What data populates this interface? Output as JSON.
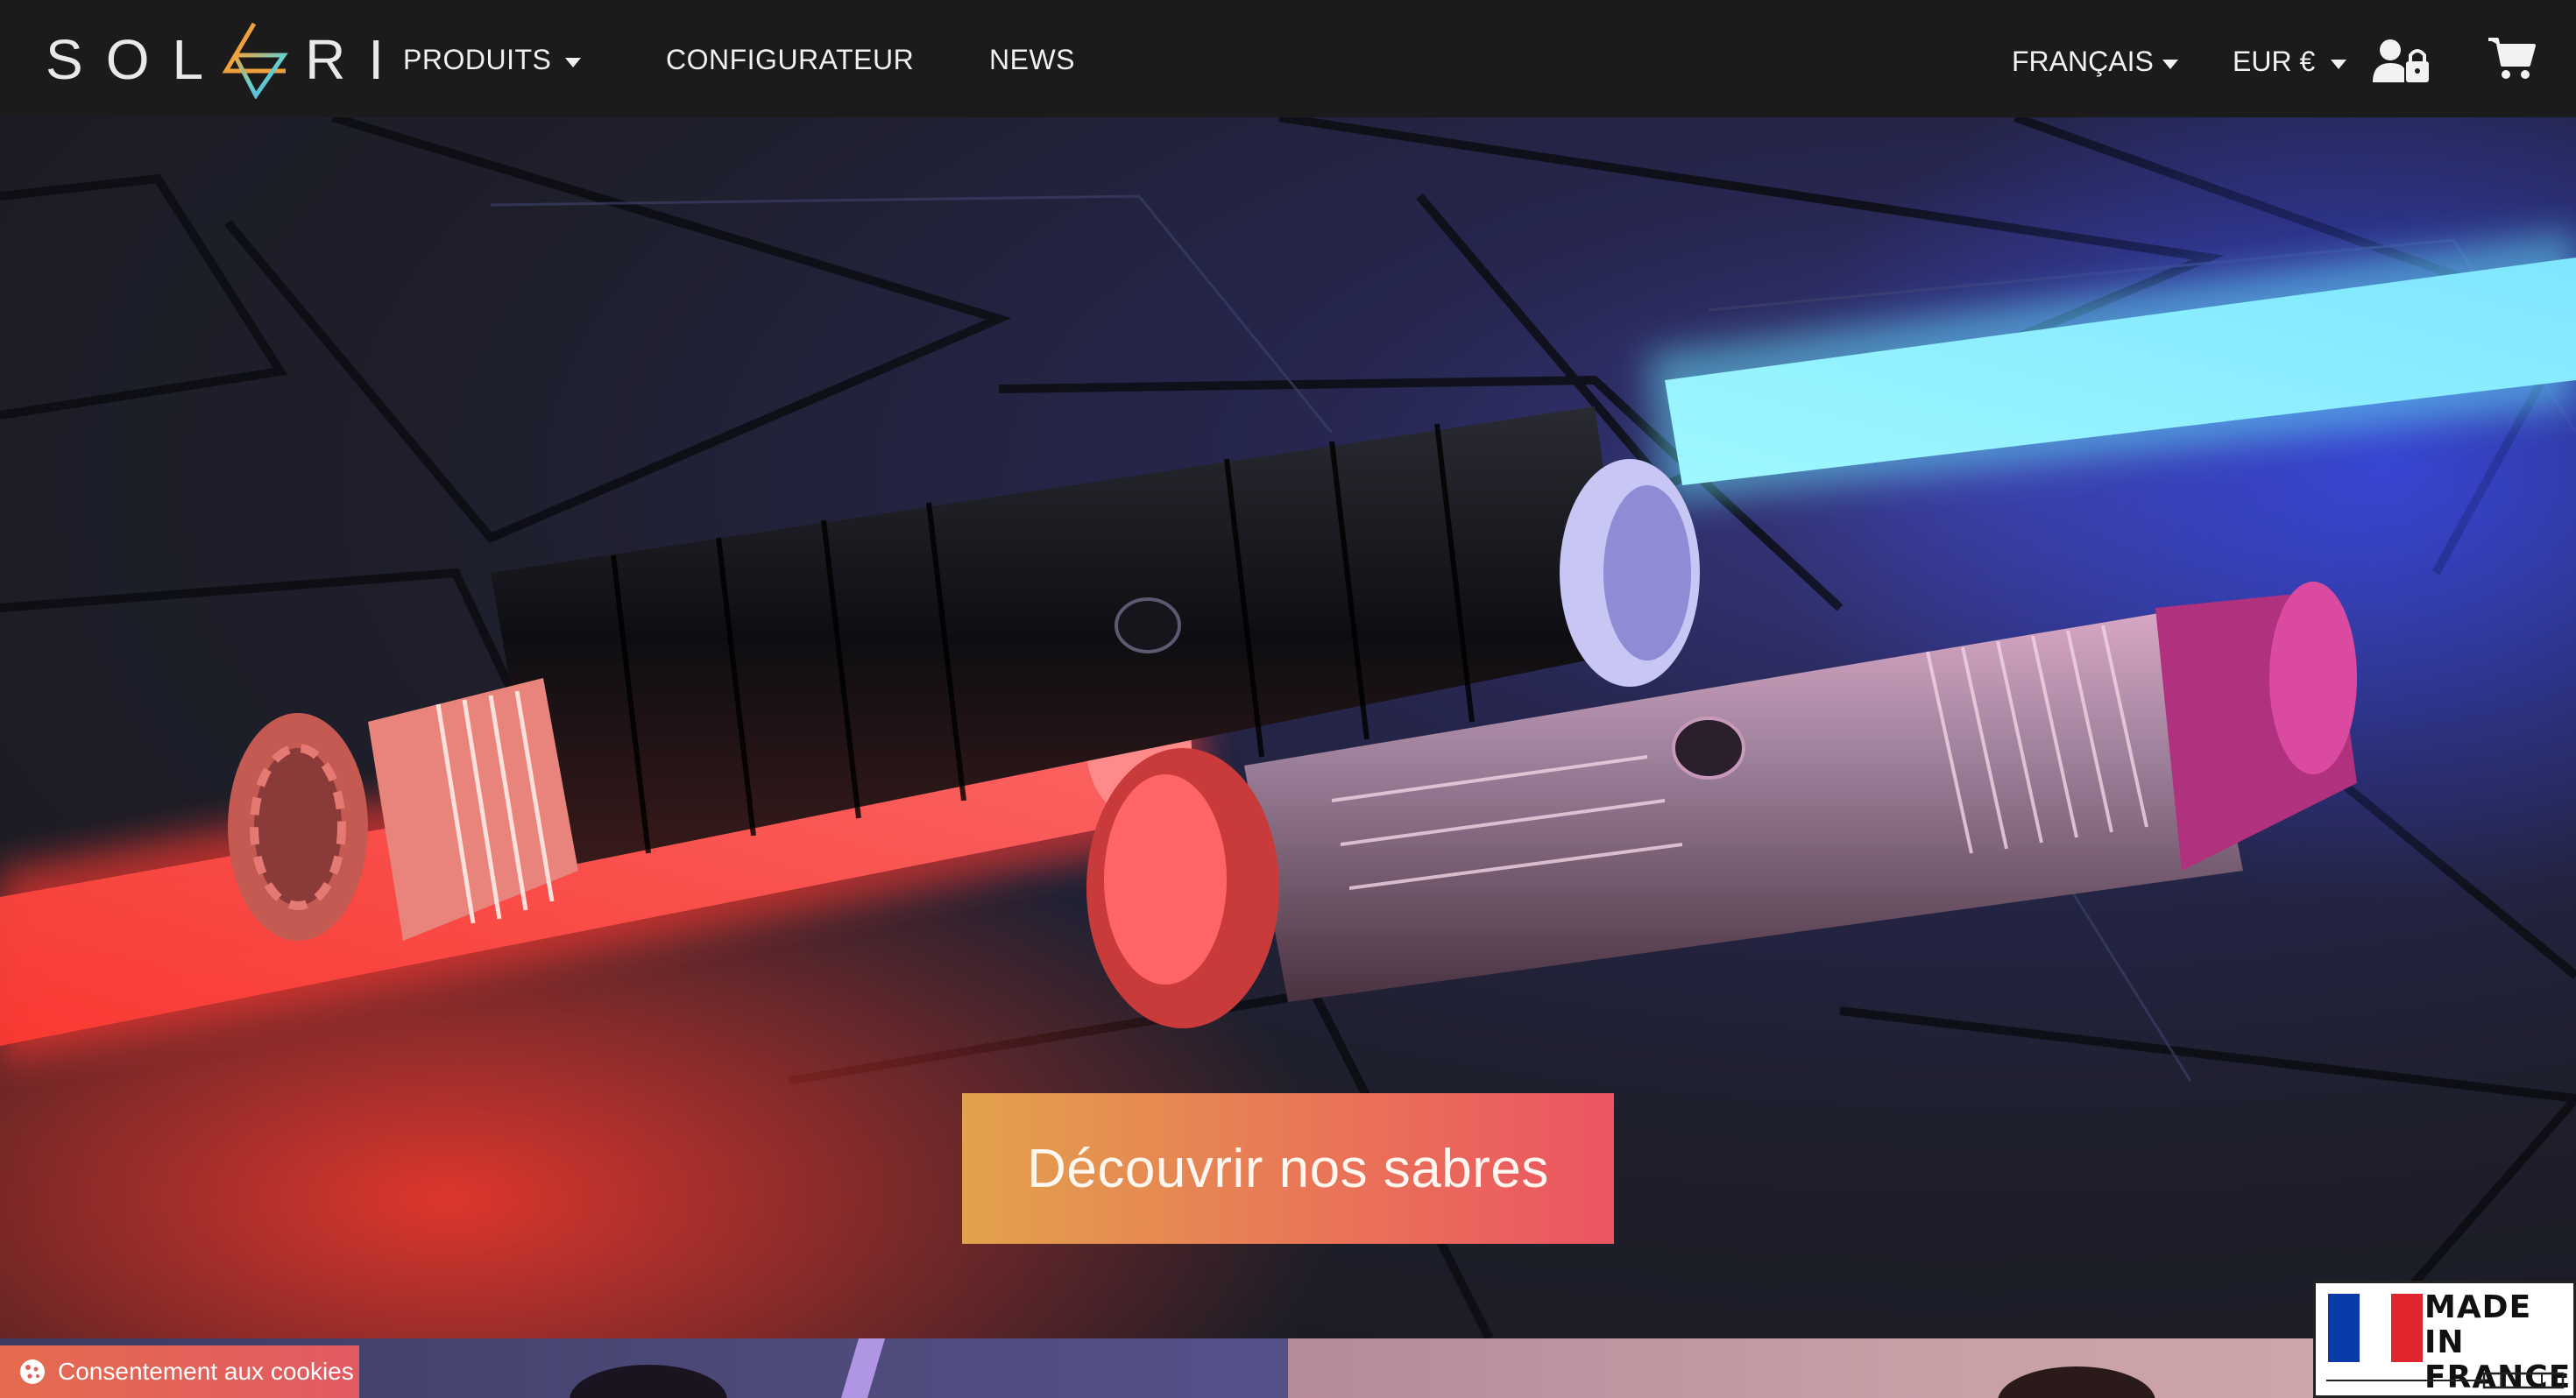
{
  "navbar": {
    "logo_text_left": "SOL",
    "logo_text_right": "RI",
    "links": [
      {
        "label": "PRODUITS",
        "has_dropdown": true
      },
      {
        "label": "CONFIGURATEUR",
        "has_dropdown": false
      },
      {
        "label": "NEWS",
        "has_dropdown": false
      }
    ],
    "language": "FRANÇAIS",
    "currency": "EUR €",
    "account_icon": "user-lock-icon",
    "cart_icon": "shopping-cart-icon"
  },
  "hero": {
    "cta_label": "Découvrir nos sabres"
  },
  "cookie": {
    "label": "Consentement aux cookies",
    "icon": "cookie-icon"
  },
  "badge": {
    "line1": "MADE IN",
    "line2": "FRANCE",
    "flag_colors": [
      "#0a3ba8",
      "#ffffff",
      "#e0252f"
    ]
  },
  "colors": {
    "nav_bg": "#1b1b1b",
    "cta_start": "#e2a24c",
    "cta_end": "#ec5462",
    "saber_red": "#ff5a5a",
    "saber_blue": "#8ff0ff"
  }
}
